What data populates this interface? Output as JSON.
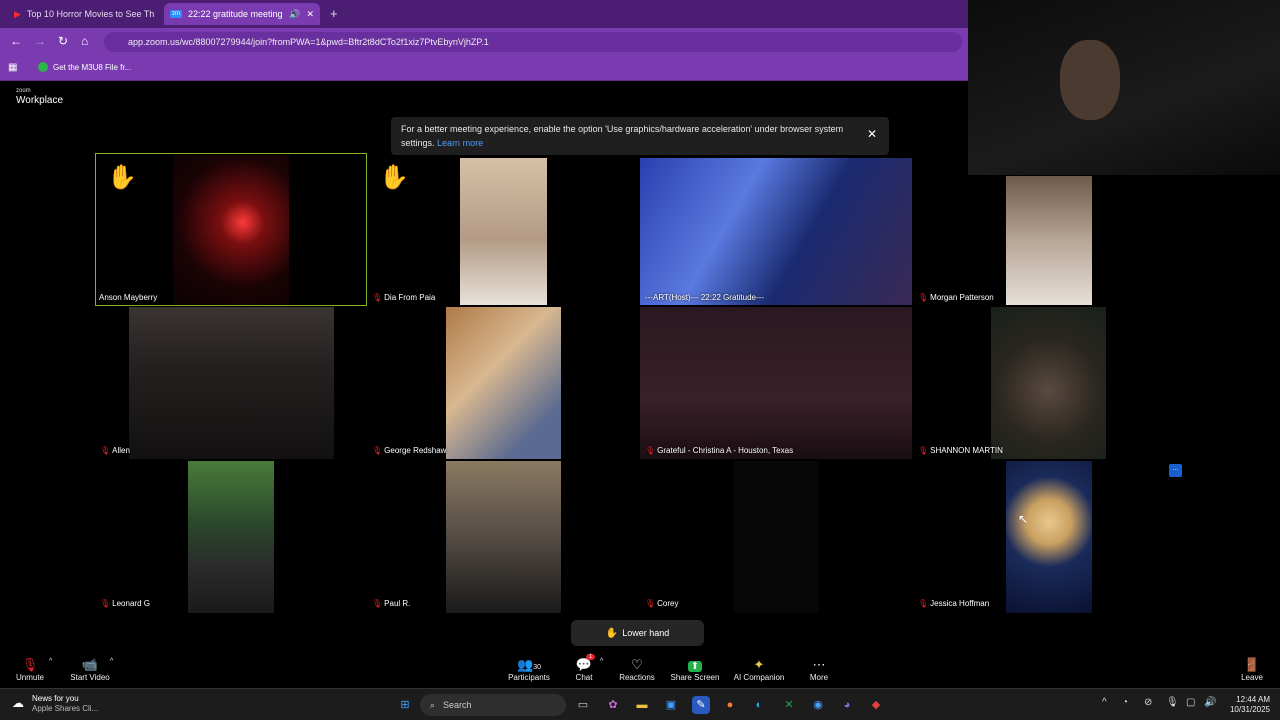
{
  "browser": {
    "tabs": [
      {
        "title": "Top 10 Horror Movies to See Th"
      },
      {
        "title": "22:22 gratitude meeting"
      }
    ],
    "url": "app.zoom.us/wc/88007279944/join?fromPWA=1&pwd=Bftr2t8dCTo2f1xiz7PtvEbynVjhZP.1",
    "bookmark": "Get the M3U8 File fr..."
  },
  "zoom": {
    "logo_small": "zoom",
    "logo_big": "Workplace",
    "banner_text": "For a better meeting experience, enable the option 'Use graphics/hardware acceleration' under browser system settings.",
    "banner_link": "Learn more",
    "participants": [
      {
        "name": "Anson Mayberry",
        "muted": false,
        "hand": true
      },
      {
        "name": "Dia From Paia",
        "muted": true,
        "hand": true
      },
      {
        "name": "---ART(Host)--- 22:22 Gratitude---",
        "muted": false,
        "hand": false
      },
      {
        "name": "Morgan Patterson",
        "muted": true,
        "hand": false
      },
      {
        "name": "Allen",
        "muted": true,
        "hand": false
      },
      {
        "name": "George Redshaw",
        "muted": true,
        "hand": false
      },
      {
        "name": "Grateful - Christina A - Houston, Texas",
        "muted": true,
        "hand": false
      },
      {
        "name": "SHANNON MARTIN",
        "muted": true,
        "hand": false
      },
      {
        "name": "Leonard G",
        "muted": true,
        "hand": false
      },
      {
        "name": "Paul R.",
        "muted": true,
        "hand": false
      },
      {
        "name": "Corey",
        "muted": true,
        "hand": false
      },
      {
        "name": "Jessica Hoffman",
        "muted": true,
        "hand": false
      }
    ],
    "lower_hand": "Lower hand",
    "toolbar": {
      "unmute": "Unmute",
      "start_video": "Start Video",
      "participants": "Participants",
      "participants_count": "30",
      "chat": "Chat",
      "chat_badge": "1",
      "reactions": "Reactions",
      "share_screen": "Share Screen",
      "ai_companion": "AI Companion",
      "more": "More",
      "leave": "Leave"
    }
  },
  "taskbar": {
    "news_title": "News for you",
    "news_sub": "Apple Shares Cli...",
    "search": "Search",
    "time": "12:44 AM",
    "date": "10/31/2025"
  },
  "colors": {
    "browser_accent": "#7a3bb0",
    "muted": "#e0242a",
    "active_speaker": "#8ab02a"
  }
}
